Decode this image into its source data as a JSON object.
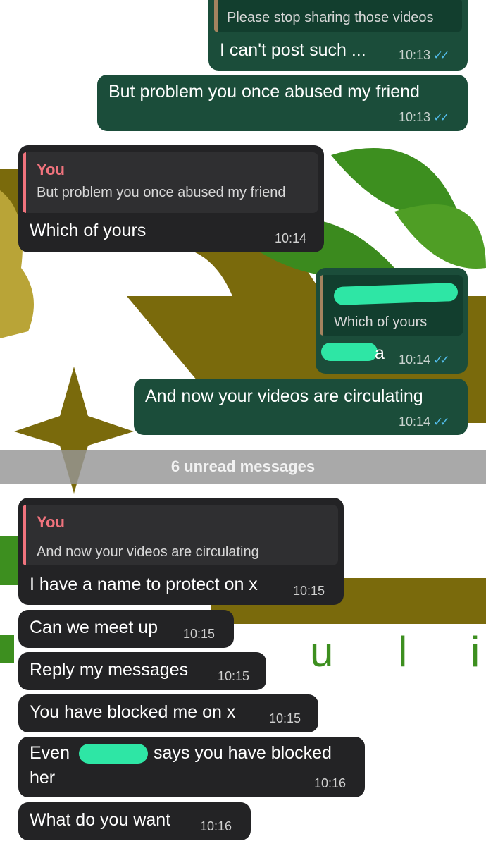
{
  "colors": {
    "outgoing_bubble": "#1b4d3a",
    "incoming_bubble": "#232325",
    "read_ticks": "#53bdeb",
    "quote_sender": "#f0737d",
    "redaction": "#2ee6a5"
  },
  "background_watermark_text": [
    "u",
    "l",
    "i"
  ],
  "messages": [
    {
      "direction": "out",
      "quote": "Please stop sharing those videos",
      "text": "I can't post such ...",
      "time": "10:13",
      "status": "read"
    },
    {
      "direction": "out",
      "text": "But problem you once abused my friend",
      "time": "10:13",
      "status": "read"
    },
    {
      "direction": "in",
      "quote_sender": "You",
      "quote": "But problem you once abused my friend",
      "text": "Which of yours",
      "time": "10:14"
    },
    {
      "direction": "out",
      "quote": "Which of yours",
      "text": "a",
      "time": "10:14",
      "status": "read"
    },
    {
      "direction": "out",
      "text": "And now your videos are circulating",
      "time": "10:14",
      "status": "read"
    }
  ],
  "unread_divider": "6 unread messages",
  "unread_messages": [
    {
      "direction": "in",
      "quote_sender": "You",
      "quote": "And now your videos are circulating",
      "text": "I have a name to protect on x",
      "time": "10:15"
    },
    {
      "direction": "in",
      "text": "Can we meet up",
      "time": "10:15"
    },
    {
      "direction": "in",
      "text": "Reply my messages",
      "time": "10:15"
    },
    {
      "direction": "in",
      "text": "You have blocked me on x",
      "time": "10:15"
    },
    {
      "direction": "in",
      "text_start": "Even",
      "text_mid": "says you have blocked",
      "text_end": "her",
      "time": "10:16"
    },
    {
      "direction": "in",
      "text": "What do you want",
      "time": "10:16"
    }
  ],
  "tick_glyph": "✓✓"
}
